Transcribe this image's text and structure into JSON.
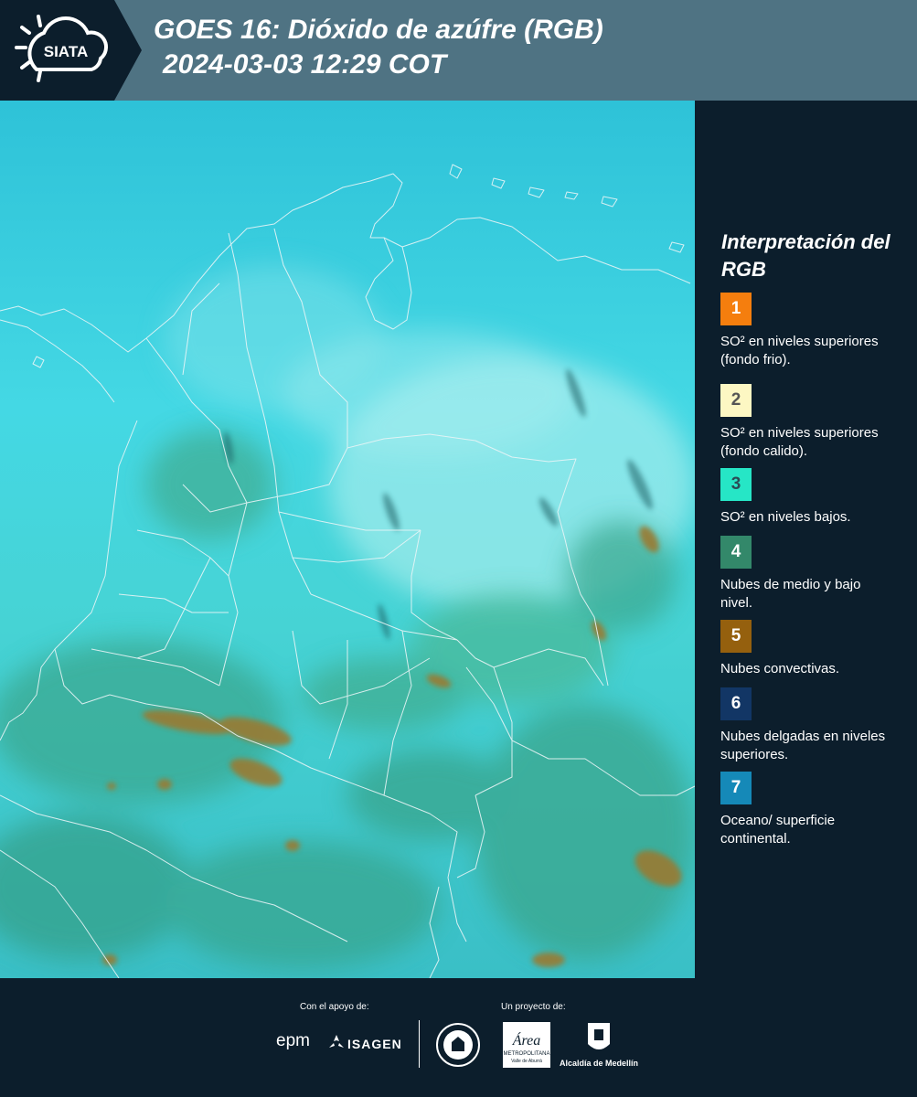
{
  "header": {
    "logo_text": "SIATA",
    "title_line1": "GOES 16: Dióxido de azúfre (RGB)",
    "title_line2": "2024-03-03 12:29 COT"
  },
  "legend": {
    "title": "Interpretación del RGB",
    "items": [
      {
        "number": "1",
        "color": "#f57e0e",
        "number_color": "#ffffff",
        "label": "SO² en niveles superiores (fondo frio)."
      },
      {
        "number": "2",
        "color": "#fdf7c3",
        "number_color": "#555555",
        "label": "SO² en niveles superiores (fondo calido)."
      },
      {
        "number": "3",
        "color": "#26e6c6",
        "number_color": "#2b4b55",
        "label": "SO² en niveles bajos."
      },
      {
        "number": "4",
        "color": "#33886a",
        "number_color": "#ffffff",
        "label": "Nubes de medio y bajo nivel."
      },
      {
        "number": "5",
        "color": "#95600e",
        "number_color": "#ffffff",
        "label": "Nubes convectivas."
      },
      {
        "number": "6",
        "color": "#123665",
        "number_color": "#ffffff",
        "label": "Nubes delgadas en niveles superiores."
      },
      {
        "number": "7",
        "color": "#1589b8",
        "number_color": "#ffffff",
        "label": "Oceano/ superficie continental."
      }
    ]
  },
  "footer": {
    "support_label": "Con el apoyo de:",
    "project_label": "Un proyecto de:",
    "epm_logo": "epm",
    "isagen_logo": "ISAGEN",
    "area_logo_main": "Área",
    "area_logo_sub": "METROPOLITANA",
    "area_logo_sub2": "Valle de Aburrá",
    "alcaldia_text": "Alcaldía de Medellín"
  }
}
